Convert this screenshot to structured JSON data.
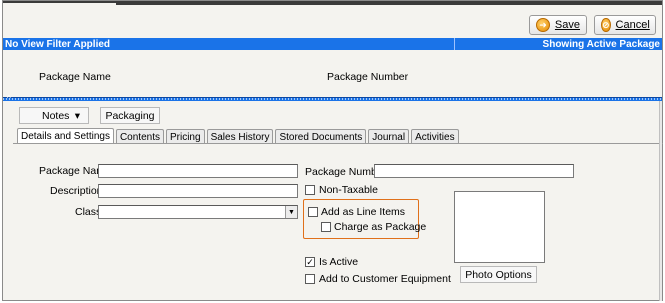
{
  "toolbar": {
    "save_label": "Save",
    "cancel_label": "Cancel",
    "save_icon": "arrow-circle-icon",
    "cancel_icon": "cancel-circle-icon"
  },
  "status_bar": {
    "filter_text": "No View Filter Applied",
    "showing_text": "Showing Active Package"
  },
  "grid": {
    "columns": [
      "Package Name",
      "Package Number"
    ]
  },
  "actions": {
    "notes_label": "Notes",
    "notes_arrow": "▾",
    "packaging_label": "Packaging"
  },
  "tabs": [
    {
      "label": "Details and Settings",
      "active": true
    },
    {
      "label": "Contents",
      "active": false
    },
    {
      "label": "Pricing",
      "active": false
    },
    {
      "label": "Sales History",
      "active": false
    },
    {
      "label": "Stored Documents",
      "active": false
    },
    {
      "label": "Journal",
      "active": false
    },
    {
      "label": "Activities",
      "active": false
    }
  ],
  "form": {
    "package_name_label": "Package Name",
    "package_name_value": "",
    "description_label": "Description",
    "description_value": "",
    "class_label": "Class",
    "class_value": "",
    "package_number_label": "Package Number",
    "package_number_value": "",
    "non_taxable_label": "Non-Taxable",
    "non_taxable_checked": false,
    "add_as_line_items_label": "Add as Line Items",
    "add_as_line_items_checked": false,
    "charge_as_package_label": "Charge as Package",
    "charge_as_package_checked": false,
    "is_active_label": "Is Active",
    "is_active_checked": true,
    "is_active_mark": "✓",
    "add_to_customer_equipment_label": "Add to Customer Equipment",
    "add_to_customer_equipment_checked": false,
    "photo_options_label": "Photo Options"
  },
  "colors": {
    "accent_blue": "#1a73e8",
    "highlight_orange": "#e0701a",
    "toolbar_icon_orange": "#e58a00"
  }
}
